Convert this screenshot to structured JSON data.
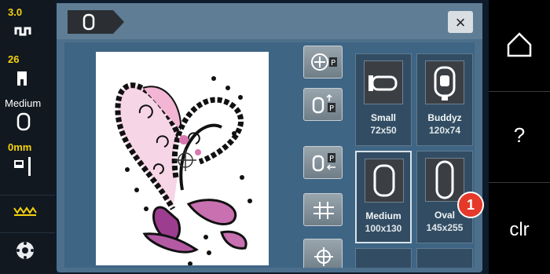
{
  "status": {
    "tension_value": "3.0",
    "foot_value": "26",
    "hoop_value": "Medium",
    "thread_value": "0mm"
  },
  "header": {
    "close_label": "×"
  },
  "hoops": [
    {
      "name": "Small",
      "size": "72x50"
    },
    {
      "name": "Buddyz",
      "size": "120x74"
    },
    {
      "name": "Medium",
      "size": "100x130"
    },
    {
      "name": "Oval",
      "size": "145x255"
    }
  ],
  "selected_hoop": "Medium",
  "annotation": {
    "badge": "1"
  },
  "nav": {
    "help_label": "?",
    "clear_label": "clr"
  },
  "colors": {
    "accent": "#e53929",
    "status_yellow": "#f5d20e",
    "design_pink": "#d978b0",
    "design_purple": "#9c3d8f"
  }
}
